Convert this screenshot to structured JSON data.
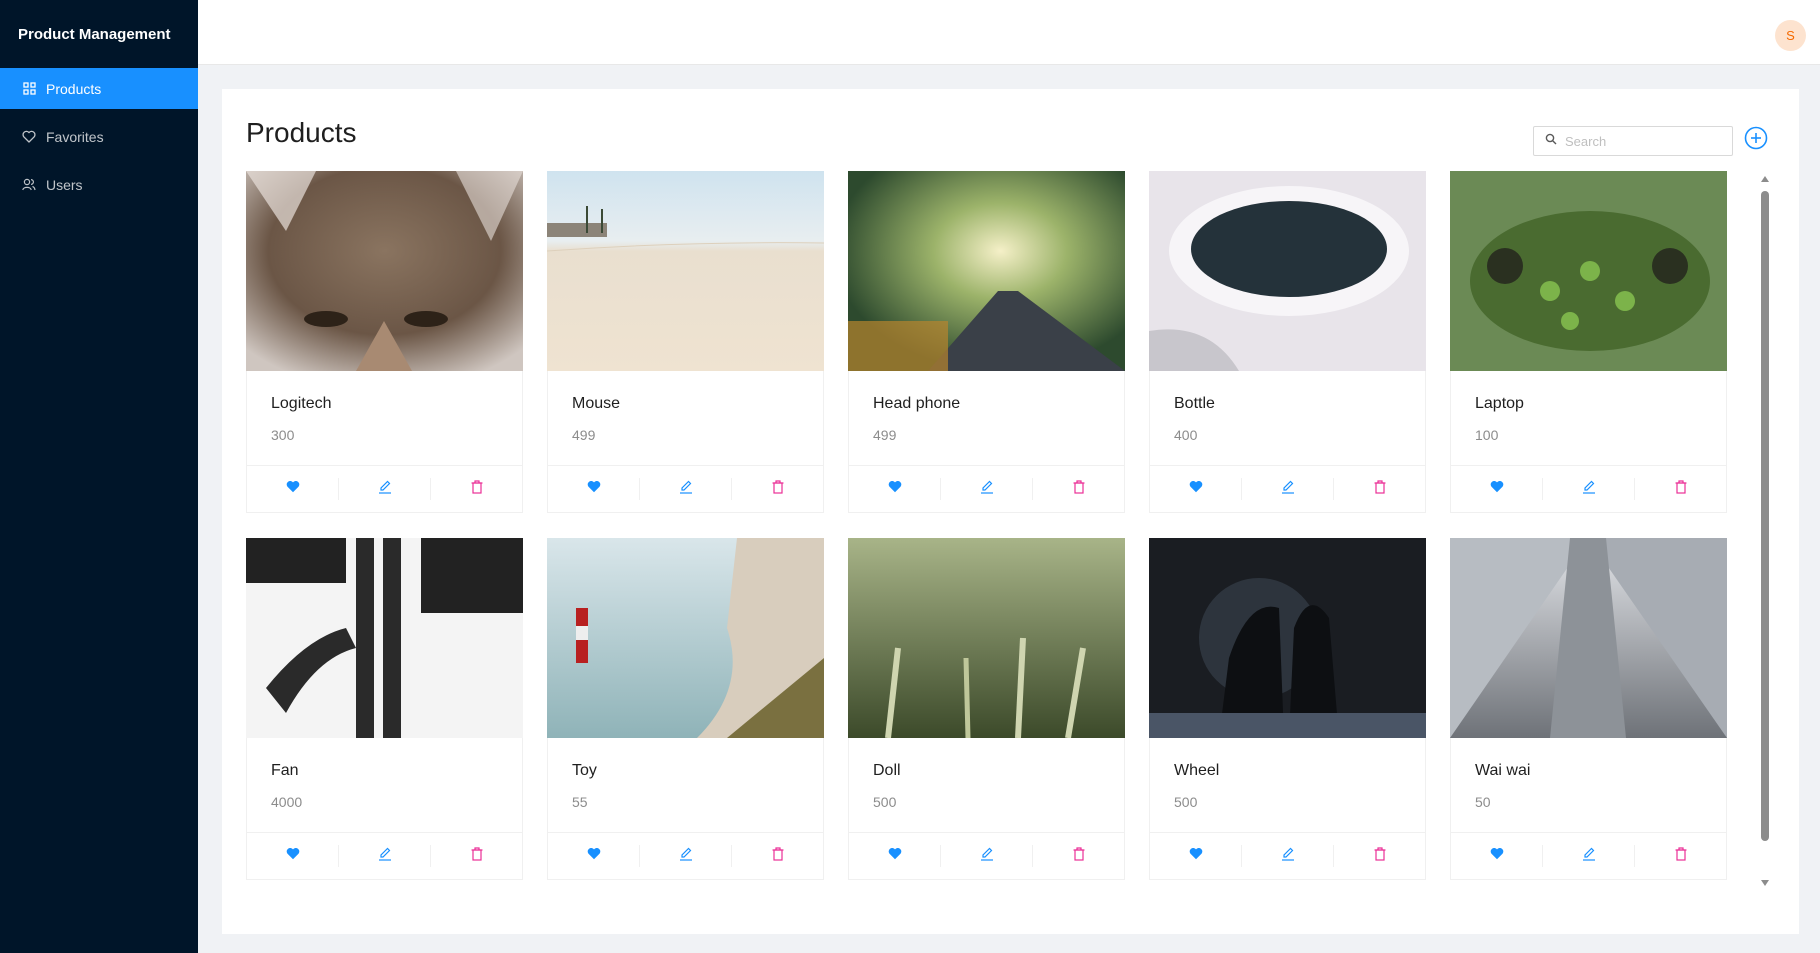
{
  "app": {
    "brand": "Product Management"
  },
  "sidebar": {
    "items": [
      {
        "label": "Products",
        "icon": "appstore-icon",
        "active": true
      },
      {
        "label": "Favorites",
        "icon": "heart-icon",
        "active": false
      },
      {
        "label": "Users",
        "icon": "users-icon",
        "active": false
      }
    ]
  },
  "header": {
    "avatar_letter": "S"
  },
  "main": {
    "title": "Products",
    "search": {
      "placeholder": "Search",
      "value": ""
    },
    "add_icon": "plus-circle-icon",
    "products": [
      {
        "name": "Logitech",
        "price": "300",
        "image": "fox"
      },
      {
        "name": "Mouse",
        "price": "499",
        "image": "beach"
      },
      {
        "name": "Head phone",
        "price": "499",
        "image": "forest-road"
      },
      {
        "name": "Bottle",
        "price": "400",
        "image": "coffee-cup"
      },
      {
        "name": "Laptop",
        "price": "100",
        "image": "frog"
      },
      {
        "name": "Fan",
        "price": "4000",
        "image": "architecture"
      },
      {
        "name": "Toy",
        "price": "55",
        "image": "lighthouse"
      },
      {
        "name": "Doll",
        "price": "500",
        "image": "wheat"
      },
      {
        "name": "Wheel",
        "price": "500",
        "image": "night-couple"
      },
      {
        "name": "Wai wai",
        "price": "50",
        "image": "skyscraper"
      }
    ],
    "card_actions": [
      "heart-icon",
      "edit-icon",
      "delete-icon"
    ]
  },
  "colors": {
    "sidebar_bg": "#001529",
    "primary": "#1890ff",
    "danger": "#eb2f96",
    "avatar_bg": "#fde3cf",
    "avatar_fg": "#f56a00"
  }
}
